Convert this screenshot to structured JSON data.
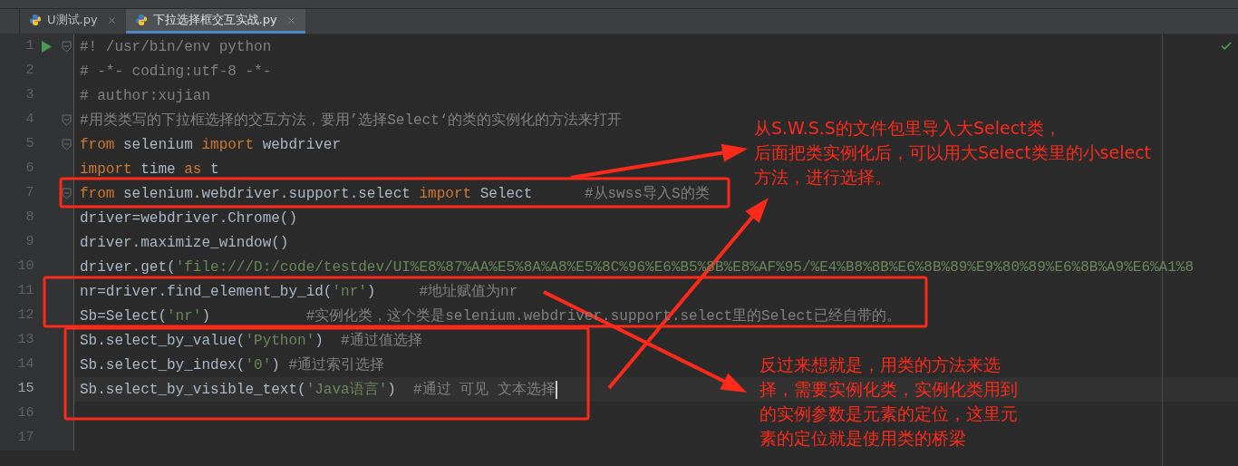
{
  "tabs": [
    {
      "label": "U测试.py",
      "selected": false
    },
    {
      "label": "下拉选择框交互实战.py",
      "selected": true
    }
  ],
  "editor": {
    "lines": [
      {
        "number": "1",
        "current": false,
        "runnable": true,
        "fold": true,
        "tokens": [
          {
            "kind": "comment",
            "text": "#! /usr/bin/env python"
          }
        ]
      },
      {
        "number": "2",
        "current": false,
        "runnable": false,
        "fold": false,
        "tokens": [
          {
            "kind": "comment",
            "text": "# -*- coding:utf-8 -*-"
          }
        ]
      },
      {
        "number": "3",
        "current": false,
        "runnable": false,
        "fold": false,
        "tokens": [
          {
            "kind": "comment",
            "text": "# author:xujian"
          }
        ]
      },
      {
        "number": "4",
        "current": false,
        "runnable": false,
        "fold": true,
        "tokens": [
          {
            "kind": "comment",
            "text": "#用类类写的下拉框选择的交互方法，要用’选择Select‘的类的实例化的方法来打开"
          }
        ]
      },
      {
        "number": "5",
        "current": false,
        "runnable": false,
        "fold": true,
        "tokens": [
          {
            "kind": "keyword",
            "text": "from"
          },
          {
            "kind": "plain",
            "text": " selenium "
          },
          {
            "kind": "keyword",
            "text": "import"
          },
          {
            "kind": "plain",
            "text": " webdriver"
          }
        ]
      },
      {
        "number": "6",
        "current": false,
        "runnable": false,
        "fold": false,
        "tokens": [
          {
            "kind": "keyword",
            "text": "import"
          },
          {
            "kind": "plain",
            "text": " time "
          },
          {
            "kind": "keyword",
            "text": "as"
          },
          {
            "kind": "plain",
            "text": " t"
          }
        ]
      },
      {
        "number": "7",
        "current": false,
        "runnable": false,
        "fold": true,
        "tokens": [
          {
            "kind": "keyword",
            "text": "from"
          },
          {
            "kind": "plain",
            "text": " selenium.webdriver.support.select "
          },
          {
            "kind": "keyword",
            "text": "import"
          },
          {
            "kind": "plain",
            "text": " Select      "
          },
          {
            "kind": "comment",
            "text": "#从swss导入S的类"
          }
        ]
      },
      {
        "number": "8",
        "current": false,
        "runnable": false,
        "fold": false,
        "tokens": [
          {
            "kind": "plain",
            "text": "driver=webdriver.Chrome()"
          }
        ]
      },
      {
        "number": "9",
        "current": false,
        "runnable": false,
        "fold": false,
        "tokens": [
          {
            "kind": "plain",
            "text": "driver.maximize_window()"
          }
        ]
      },
      {
        "number": "10",
        "current": false,
        "runnable": false,
        "fold": false,
        "tokens": [
          {
            "kind": "plain",
            "text": "driver.get("
          },
          {
            "kind": "string",
            "text": "'file:///D:/code/testdev/UI%E8%87%AA%E5%8A%A8%E5%8C%96%E6%B5%8B%E8%AF%95/%E4%B8%8B%E6%8B%89%E9%80%89%E6%8B%A9%E6%A1%8"
          }
        ]
      },
      {
        "number": "11",
        "current": false,
        "runnable": false,
        "fold": false,
        "tokens": [
          {
            "kind": "plain",
            "text": "nr=driver.find_element_by_id("
          },
          {
            "kind": "string",
            "text": "'nr'"
          },
          {
            "kind": "plain",
            "text": ")     "
          },
          {
            "kind": "comment",
            "text": "#地址赋值为nr"
          }
        ]
      },
      {
        "number": "12",
        "current": false,
        "runnable": false,
        "fold": false,
        "tokens": [
          {
            "kind": "plain",
            "text": "Sb=Select("
          },
          {
            "kind": "string",
            "text": "'nr'"
          },
          {
            "kind": "plain",
            "text": ")           "
          },
          {
            "kind": "comment",
            "text": "#实例化类，这个类是selenium.webdriver.support.select里的Select已经自带的。"
          }
        ]
      },
      {
        "number": "13",
        "current": false,
        "runnable": false,
        "fold": false,
        "tokens": [
          {
            "kind": "plain",
            "text": "Sb.select_by_value("
          },
          {
            "kind": "string",
            "text": "'Python'"
          },
          {
            "kind": "plain",
            "text": ")  "
          },
          {
            "kind": "comment",
            "text": "#通过值选择"
          }
        ]
      },
      {
        "number": "14",
        "current": false,
        "runnable": false,
        "fold": false,
        "tokens": [
          {
            "kind": "plain",
            "text": "Sb.select_by_index("
          },
          {
            "kind": "string",
            "text": "'0'"
          },
          {
            "kind": "plain",
            "text": ") "
          },
          {
            "kind": "comment",
            "text": "#通过索引选择"
          }
        ]
      },
      {
        "number": "15",
        "current": true,
        "runnable": false,
        "fold": false,
        "tokens": [
          {
            "kind": "plain",
            "text": "Sb.select_by_visible_text("
          },
          {
            "kind": "string",
            "text": "'Java语言'"
          },
          {
            "kind": "plain",
            "text": ")  "
          },
          {
            "kind": "comment",
            "text": "#通过 可见 文本选择"
          }
        ]
      },
      {
        "number": "16",
        "current": false,
        "runnable": false,
        "fold": false
      },
      {
        "number": "17",
        "current": false,
        "runnable": false,
        "fold": false
      }
    ]
  },
  "annotations": [
    {
      "lines": [
        "从S.W.S.S的文件包里导入大Select类，",
        "后面把类实例化后，可以用大Select类里的小select",
        "方法，进行选择。"
      ]
    },
    {
      "lines": [
        "反过来想就是，用类的方法来选",
        "择，需要实例化类，实例化类用到",
        "的实例参数是元素的定位，这里元",
        "素的定位就是使用类的桥梁"
      ]
    }
  ]
}
